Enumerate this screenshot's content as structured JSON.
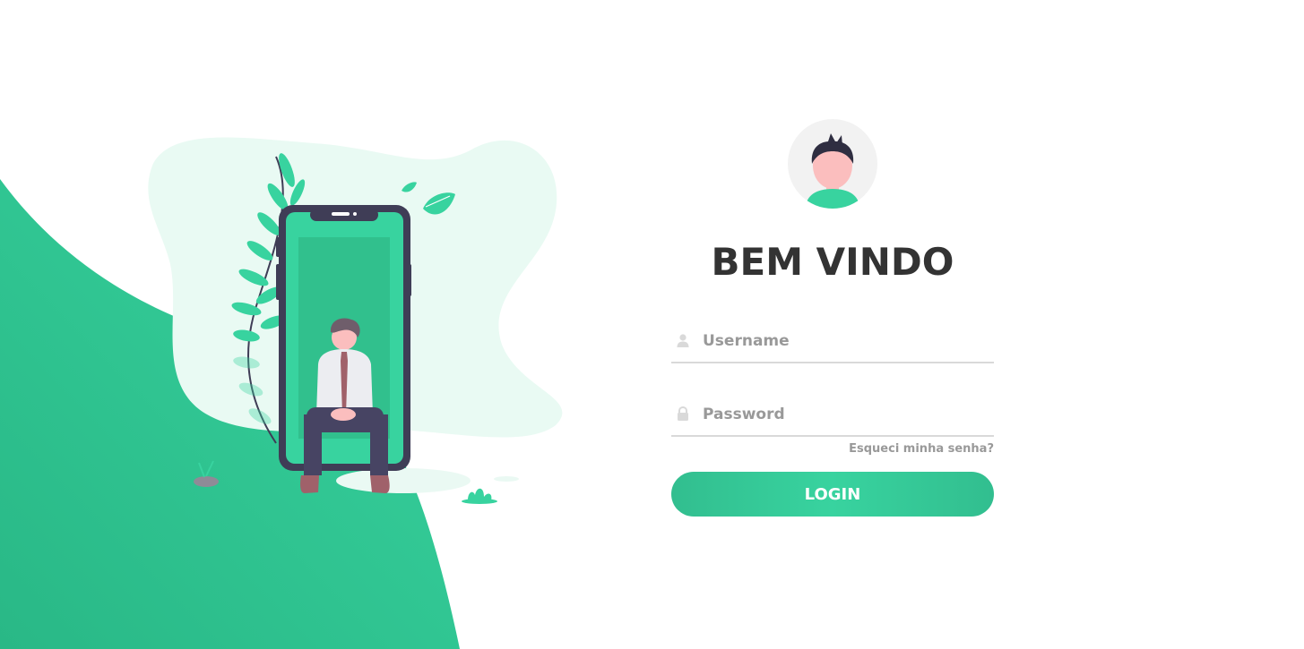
{
  "login": {
    "title": "BEM VINDO",
    "username_placeholder": "Username",
    "password_placeholder": "Password",
    "forgot_label": "Esqueci minha senha?",
    "login_label": "LOGIN"
  },
  "icons": {
    "username": "user-icon",
    "password": "lock-icon",
    "avatar": "user-avatar-icon"
  },
  "colors": {
    "accent": "#38d39f",
    "accent_dark": "#32be8f",
    "title": "#333333",
    "muted": "#999999",
    "phone_frame": "#3f3d56"
  }
}
